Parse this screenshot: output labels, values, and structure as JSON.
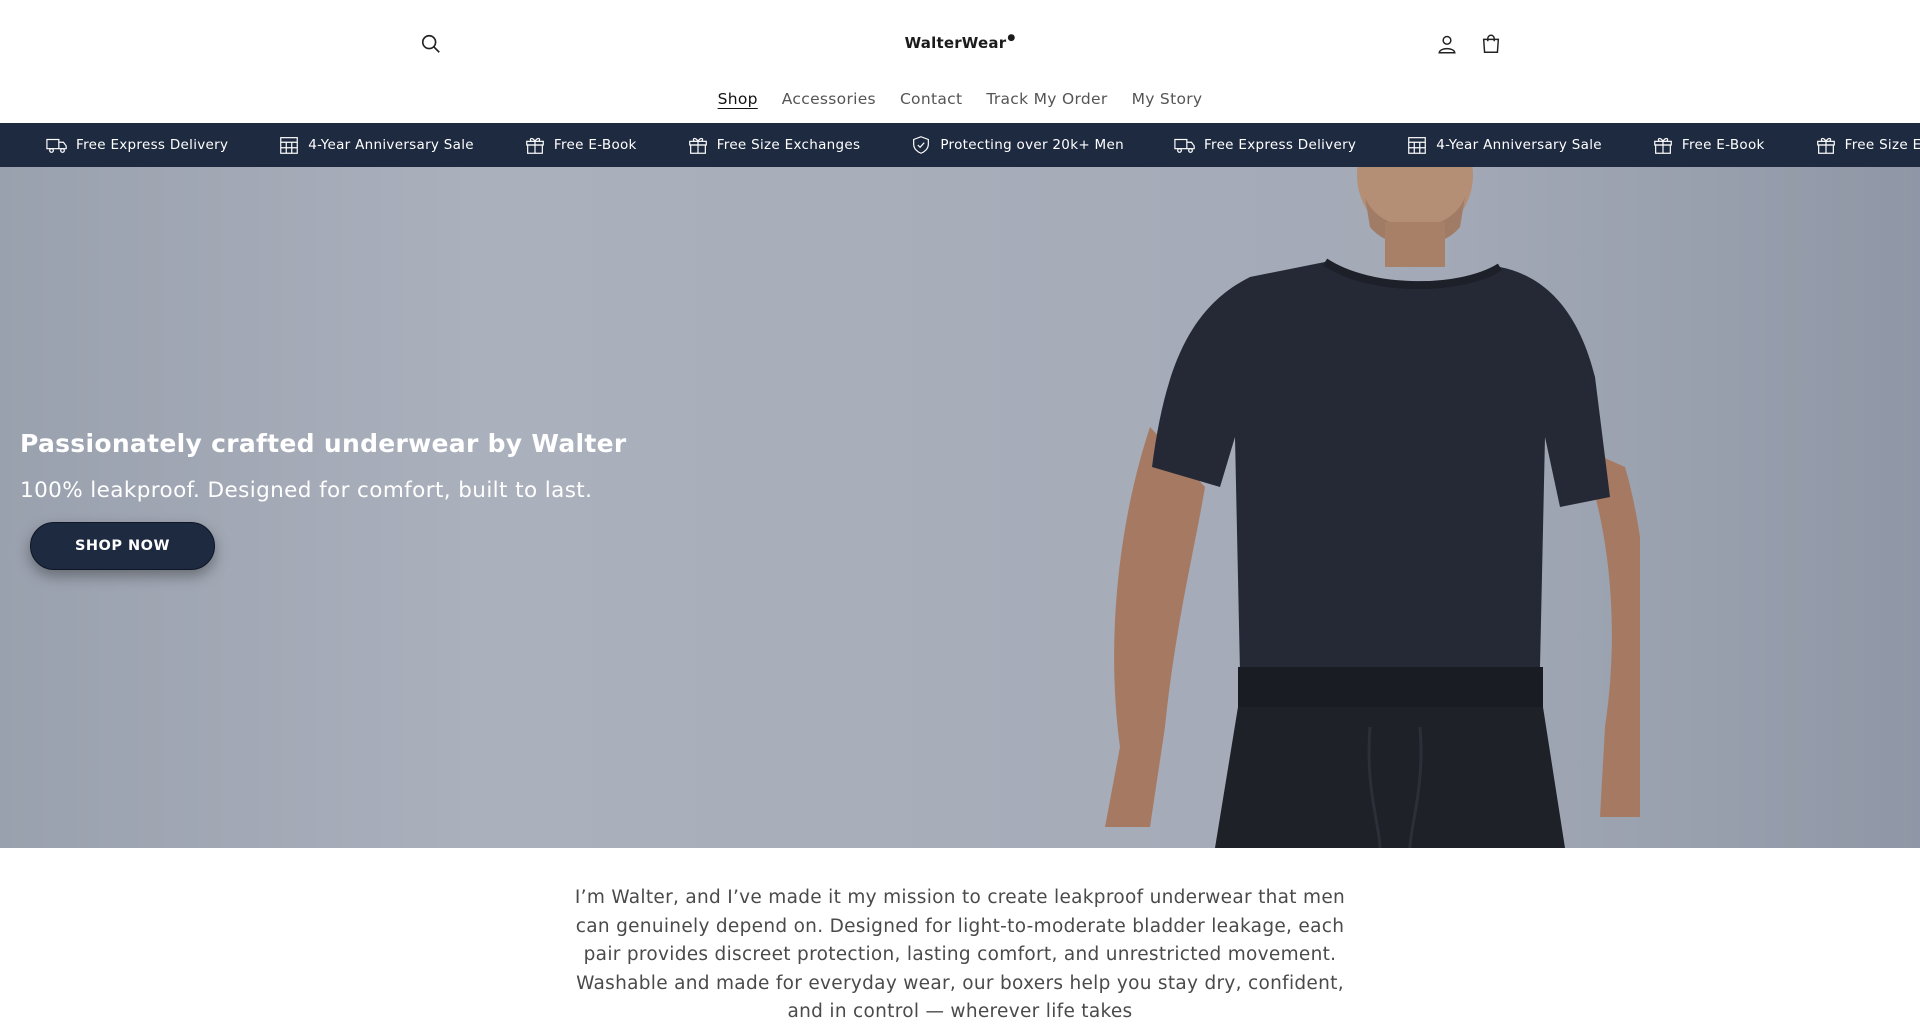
{
  "header": {
    "logo_text": "WalterWear",
    "logo_mark": "💧",
    "icons": {
      "search": "search-icon",
      "account": "account-icon",
      "cart": "cart-icon"
    }
  },
  "nav": {
    "items": [
      {
        "label": "Shop",
        "active": true
      },
      {
        "label": "Accessories"
      },
      {
        "label": "Contact"
      },
      {
        "label": "Track My Order"
      },
      {
        "label": "My Story"
      }
    ]
  },
  "announcement": {
    "background": "#1e2a40",
    "items": [
      {
        "label": "Free Express Delivery",
        "icon": "truck-icon"
      },
      {
        "label": "4-Year Anniversary Sale",
        "icon": "calendar-icon"
      },
      {
        "label": "Free E-Book",
        "icon": "gift-icon"
      },
      {
        "label": "Free Size Exchanges",
        "icon": "gift-icon"
      },
      {
        "label": "Protecting over 20k+ Men",
        "icon": "shield-icon"
      },
      {
        "label": "Free Express Delivery",
        "icon": "truck-icon"
      },
      {
        "label": "4-Year Anniversary Sale",
        "icon": "calendar-icon"
      },
      {
        "label": "Free E-Book",
        "icon": "gift-icon"
      },
      {
        "label": "Free Size Exchanges",
        "icon": "gift-icon"
      }
    ]
  },
  "hero": {
    "title": "Passionately crafted underwear by Walter",
    "subtitle": "100% leakproof. Designed for comfort, built to last.",
    "cta_label": "SHOP NOW"
  },
  "story": {
    "text": "I’m Walter, and I’ve made it my mission to create leakproof underwear that men can genuinely depend on. Designed for light-to-moderate bladder leakage, each pair provides discreet protection, lasting comfort, and unrestricted movement. Washable and made for everyday wear, our boxers help you stay dry, confident, and in control — wherever life takes"
  }
}
